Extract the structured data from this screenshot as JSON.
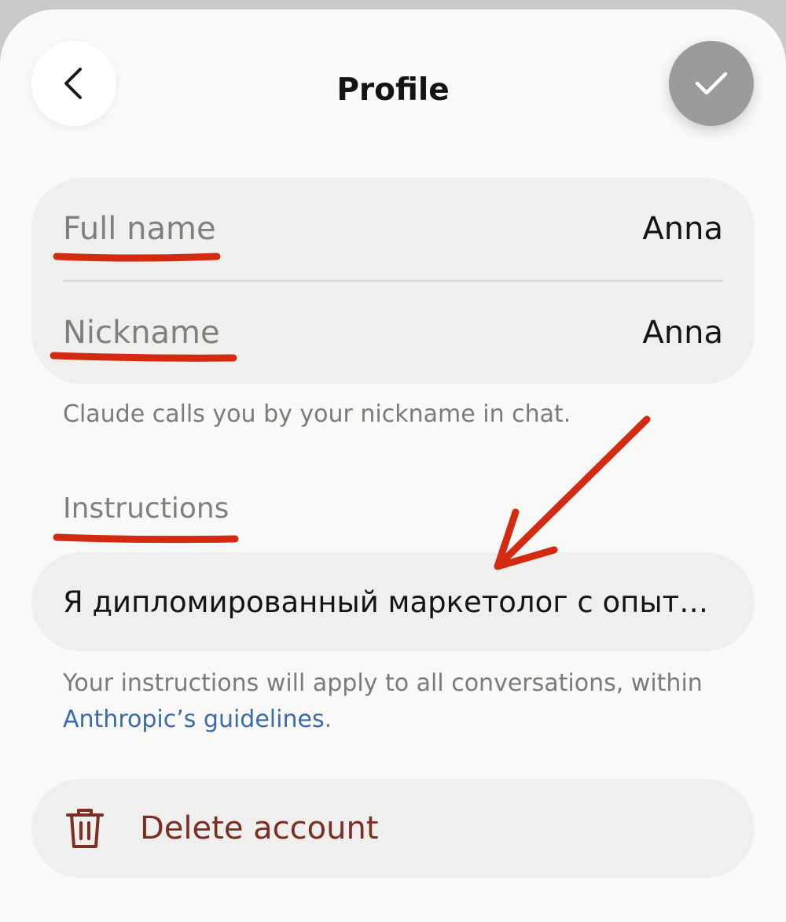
{
  "header": {
    "title": "Profile",
    "back_icon": "chevron-left-icon",
    "done_icon": "check-icon"
  },
  "profile": {
    "full_name_label": "Full name",
    "full_name_value": "Anna",
    "nickname_label": "Nickname",
    "nickname_value": "Anna",
    "nickname_hint": "Claude calls you by your nickname in chat."
  },
  "instructions": {
    "label": "Instructions",
    "value": "Я дипломированный маркетолог с опыт…",
    "hint_text": "Your instructions will apply to all conversations, within",
    "hint_link": "Anthropic’s guidelines",
    "hint_end": "."
  },
  "account": {
    "delete_label": "Delete account",
    "delete_icon": "trash-icon"
  },
  "colors": {
    "annotation": "#d52a12",
    "link": "#3b6ab0",
    "danger": "#7d2d24"
  }
}
